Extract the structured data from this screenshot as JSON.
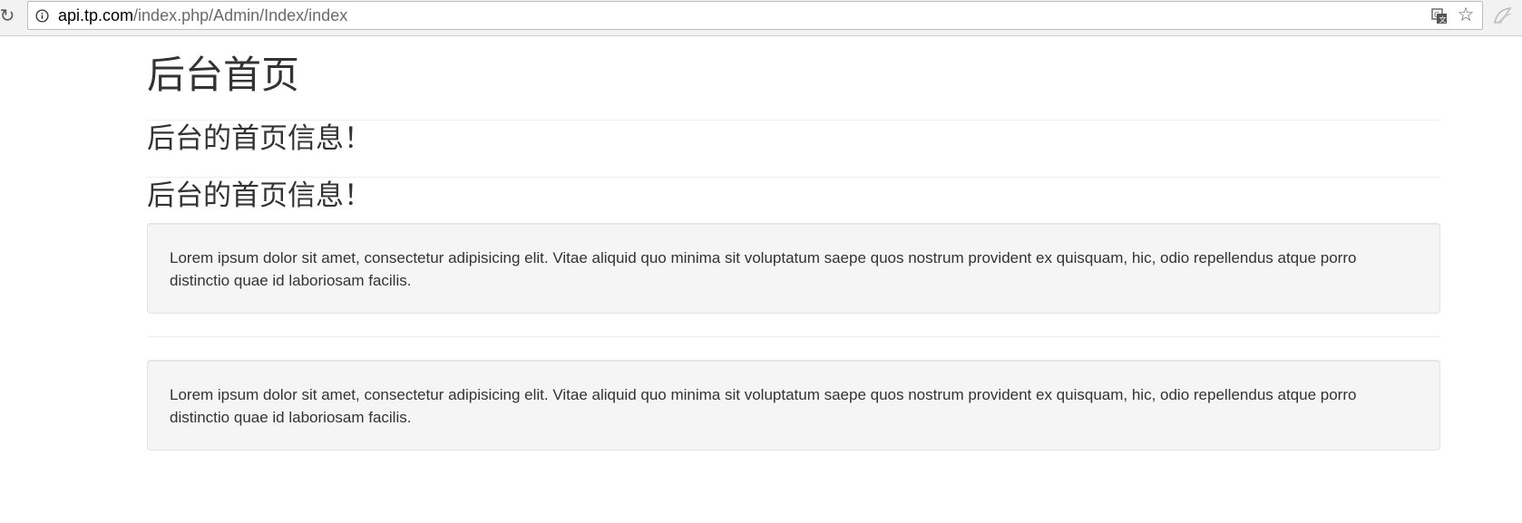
{
  "browser": {
    "reload_icon": "reload-icon",
    "url_host": "api.tp.com",
    "url_path": "/index.php/Admin/Index/index",
    "info_icon": "info-icon",
    "translate_icon": "translate-icon",
    "star_icon": "star-icon",
    "extension_icon": "extension-icon"
  },
  "page": {
    "title": "后台首页",
    "subtitle_1": "后台的首页信息！",
    "subtitle_2": "后台的首页信息！",
    "well_1_text": "Lorem ipsum dolor sit amet, consectetur adipisicing elit. Vitae aliquid quo minima sit voluptatum saepe quos nostrum provident ex quisquam, hic, odio repellendus atque porro distinctio quae id laboriosam facilis.",
    "well_2_text": "Lorem ipsum dolor sit amet, consectetur adipisicing elit. Vitae aliquid quo minima sit voluptatum saepe quos nostrum provident ex quisquam, hic, odio repellendus atque porro distinctio quae id laboriosam facilis."
  }
}
